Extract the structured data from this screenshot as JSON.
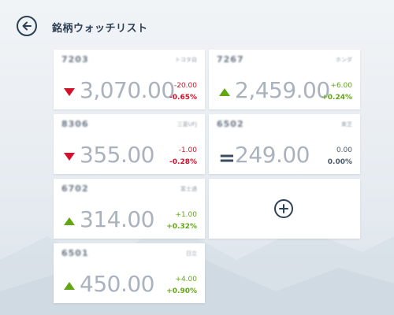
{
  "header": {
    "title": "銘柄ウォッチリスト",
    "back_icon": "back-arrow-icon"
  },
  "colors": {
    "down": "#d2112a",
    "up": "#62a515",
    "flat": "#4a5868",
    "price": "#aab3bd"
  },
  "tiles": [
    {
      "code": "7203",
      "name": "トヨタ自",
      "price": "3,070.00",
      "change": "-20.00",
      "percent": "-0.65%",
      "trend": "down"
    },
    {
      "code": "7267",
      "name": "ホンダ",
      "price": "2,459.00",
      "change": "+6.00",
      "percent": "+0.24%",
      "trend": "up"
    },
    {
      "code": "8306",
      "name": "三菱UFJ",
      "price": "355.00",
      "change": "-1.00",
      "percent": "-0.28%",
      "trend": "down"
    },
    {
      "code": "6502",
      "name": "東芝",
      "price": "249.00",
      "change": "0.00",
      "percent": "0.00%",
      "trend": "flat"
    },
    {
      "code": "6702",
      "name": "富士通",
      "price": "314.00",
      "change": "+1.00",
      "percent": "+0.32%",
      "trend": "up"
    },
    {
      "code": "6501",
      "name": "日立",
      "price": "450.00",
      "change": "+4.00",
      "percent": "+0.90%",
      "trend": "up"
    }
  ],
  "add_tile": {
    "icon": "plus-circle-icon"
  }
}
